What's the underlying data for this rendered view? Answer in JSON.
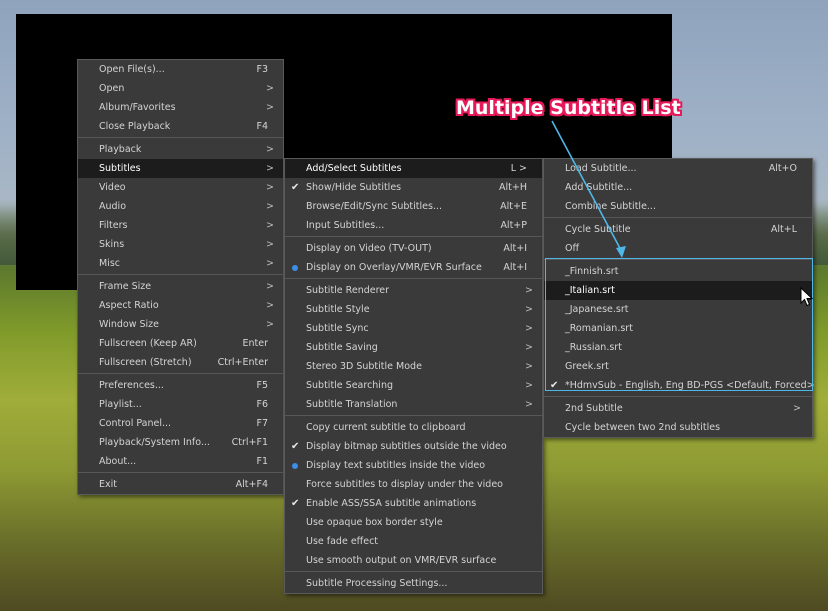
{
  "callout": {
    "text": "Multiple Subtitle List",
    "color": "#e6195a",
    "arrow_color": "#4fb6e8"
  },
  "main_menu": [
    {
      "label": "Open File(s)...",
      "shortcut": "F3"
    },
    {
      "label": "Open",
      "submenu": true
    },
    {
      "label": "Album/Favorites",
      "submenu": true
    },
    {
      "label": "Close Playback",
      "shortcut": "F4"
    },
    {
      "sep": true
    },
    {
      "label": "Playback",
      "submenu": true
    },
    {
      "label": "Subtitles",
      "submenu": true,
      "highlight": true
    },
    {
      "label": "Video",
      "submenu": true
    },
    {
      "label": "Audio",
      "submenu": true
    },
    {
      "label": "Filters",
      "submenu": true
    },
    {
      "label": "Skins",
      "submenu": true
    },
    {
      "label": "Misc",
      "submenu": true
    },
    {
      "sep": true
    },
    {
      "label": "Frame Size",
      "submenu": true
    },
    {
      "label": "Aspect Ratio",
      "submenu": true
    },
    {
      "label": "Window Size",
      "submenu": true
    },
    {
      "label": "Fullscreen (Keep AR)",
      "shortcut": "Enter"
    },
    {
      "label": "Fullscreen (Stretch)",
      "shortcut": "Ctrl+Enter"
    },
    {
      "sep": true
    },
    {
      "label": "Preferences...",
      "shortcut": "F5"
    },
    {
      "label": "Playlist...",
      "shortcut": "F6"
    },
    {
      "label": "Control Panel...",
      "shortcut": "F7"
    },
    {
      "label": "Playback/System Info...",
      "shortcut": "Ctrl+F1"
    },
    {
      "label": "About...",
      "shortcut": "F1"
    },
    {
      "sep": true
    },
    {
      "label": "Exit",
      "shortcut": "Alt+F4"
    }
  ],
  "subtitles_menu": [
    {
      "label": "Add/Select Subtitles",
      "shortcut": "L >",
      "highlight": true
    },
    {
      "label": "Show/Hide Subtitles",
      "shortcut": "Alt+H",
      "mark": "check"
    },
    {
      "label": "Browse/Edit/Sync Subtitles...",
      "shortcut": "Alt+E"
    },
    {
      "label": "Input Subtitles...",
      "shortcut": "Alt+P"
    },
    {
      "sep": true
    },
    {
      "label": "Display on Video (TV-OUT)",
      "shortcut": "Alt+I"
    },
    {
      "label": "Display on Overlay/VMR/EVR Surface",
      "shortcut": "Alt+I",
      "mark": "dot"
    },
    {
      "sep": true
    },
    {
      "label": "Subtitle Renderer",
      "submenu": true
    },
    {
      "label": "Subtitle Style",
      "submenu": true
    },
    {
      "label": "Subtitle Sync",
      "submenu": true
    },
    {
      "label": "Subtitle Saving",
      "submenu": true
    },
    {
      "label": "Stereo 3D Subtitle Mode",
      "submenu": true
    },
    {
      "label": "Subtitle Searching",
      "submenu": true
    },
    {
      "label": "Subtitle Translation",
      "submenu": true
    },
    {
      "sep": true
    },
    {
      "label": "Copy current subtitle to clipboard"
    },
    {
      "label": "Display bitmap subtitles outside the video",
      "mark": "check"
    },
    {
      "label": "Display text subtitles inside the video",
      "mark": "dot"
    },
    {
      "label": "Force subtitles to display under the video"
    },
    {
      "label": "Enable ASS/SSA subtitle animations",
      "mark": "check"
    },
    {
      "label": "Use opaque box border style"
    },
    {
      "label": "Use fade effect"
    },
    {
      "label": "Use smooth output on VMR/EVR surface"
    },
    {
      "sep": true
    },
    {
      "label": "Subtitle Processing Settings..."
    }
  ],
  "add_select_menu": [
    {
      "label": "Load Subtitle...",
      "shortcut": "Alt+O"
    },
    {
      "label": "Add Subtitle..."
    },
    {
      "label": "Combine Subtitle..."
    },
    {
      "sep": true
    },
    {
      "label": "Cycle Subtitle",
      "shortcut": "Alt+L"
    },
    {
      "label": "Off"
    },
    {
      "sep": true
    },
    {
      "label": "_Finnish.srt"
    },
    {
      "label": "_Italian.srt",
      "highlight": true
    },
    {
      "label": "_Japanese.srt"
    },
    {
      "label": "_Romanian.srt"
    },
    {
      "label": "_Russian.srt"
    },
    {
      "label": "Greek.srt"
    },
    {
      "label": "*HdmvSub - English, Eng BD-PGS <Default, Forced>",
      "mark": "check"
    },
    {
      "sep": true
    },
    {
      "label": "2nd Subtitle",
      "submenu": true
    },
    {
      "label": "Cycle between two 2nd subtitles"
    }
  ]
}
